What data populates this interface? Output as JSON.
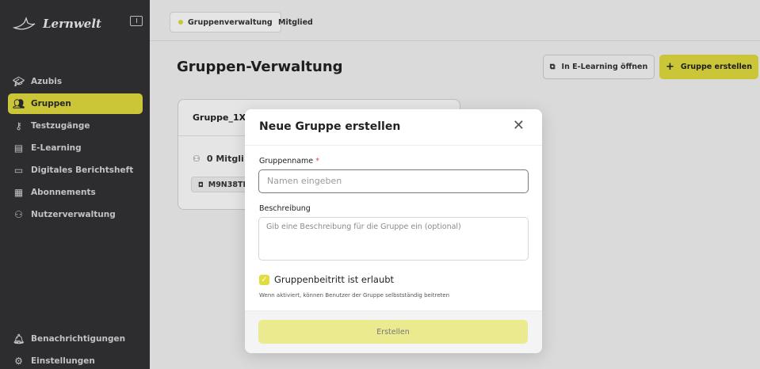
{
  "app": {
    "brand": "Lernwelt"
  },
  "sidebar": {
    "items": [
      {
        "label": "Azubis",
        "icon": "graduation-cap-icon",
        "active": false
      },
      {
        "label": "Gruppen",
        "icon": "users-icon",
        "active": true
      },
      {
        "label": "Testzugänge",
        "icon": "key-icon",
        "active": false
      },
      {
        "label": "E-Learning",
        "icon": "book-icon",
        "active": false
      },
      {
        "label": "Digitales Berichtsheft",
        "icon": "laptop-icon",
        "active": false
      },
      {
        "label": "Abonnements",
        "icon": "calendar-icon",
        "active": false
      },
      {
        "label": "Nutzerverwaltung",
        "icon": "user-settings-icon",
        "active": false
      }
    ],
    "bottom": [
      {
        "label": "Benachrichtigungen",
        "icon": "bell-icon"
      },
      {
        "label": "Einstellungen",
        "icon": "gear-icon"
      }
    ]
  },
  "topbar": {
    "tabs": [
      {
        "label": "Gruppenverwaltung",
        "active": true
      },
      {
        "label": "Mitglied",
        "active": false
      }
    ]
  },
  "main": {
    "title": "Gruppen-Verwaltung",
    "open_elearning_label": "In E-Learning öffnen",
    "create_group_label": "Gruppe erstellen",
    "group_card": {
      "name": "Gruppe_1X",
      "members": "0 Mitgli",
      "code": "M9N38TI"
    }
  },
  "modal": {
    "title": "Neue Gruppe erstellen",
    "name_label": "Gruppenname",
    "name_required": "*",
    "name_placeholder": "Namen eingeben",
    "description_label": "Beschreibung",
    "description_placeholder": "Gib eine Beschreibung für die Gruppe ein (optional)",
    "join_checkbox_label": "Gruppenbeitritt ist erlaubt",
    "join_checkbox_checked": true,
    "join_hint": "Wenn aktiviert, können Benutzer der Gruppe selbstständig beitreten",
    "submit_label": "Erstellen"
  },
  "colors": {
    "accent": "#e2dd3e",
    "sidebar_bg": "#333335",
    "required": "#e04848"
  }
}
